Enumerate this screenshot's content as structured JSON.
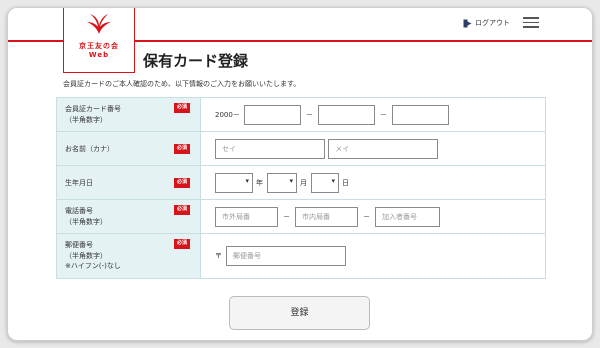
{
  "brand": {
    "name": "京王友の会",
    "sub": "Web"
  },
  "header": {
    "logout_label": "ログアウト"
  },
  "page": {
    "title": "保有カード登録",
    "intro": "会員証カードのご本人確認のため、以下情報のご入力をお願いいたします。"
  },
  "required_label": "必須",
  "form": {
    "card_number": {
      "label1": "会員証カード番号",
      "label2": "（半角数字）",
      "prefix": "2000－",
      "sep": "－"
    },
    "name": {
      "label": "お名前（カナ）",
      "sei_placeholder": "セイ",
      "mei_placeholder": "メイ"
    },
    "birth": {
      "label": "生年月日",
      "year_unit": "年",
      "month_unit": "月",
      "day_unit": "日"
    },
    "phone": {
      "label1": "電話番号",
      "label2": "（半角数字）",
      "p1": "市外局番",
      "p2": "市内局番",
      "p3": "加入者番号",
      "sep": "－"
    },
    "postal": {
      "label1": "郵便番号",
      "label2": "（半角数字）",
      "label3": "※ハイフン(-)なし",
      "prefix": "〒",
      "placeholder": "郵便番号"
    }
  },
  "submit_label": "登録",
  "colors": {
    "brand_red": "#d7141a",
    "label_bg": "#e4f2f4"
  }
}
